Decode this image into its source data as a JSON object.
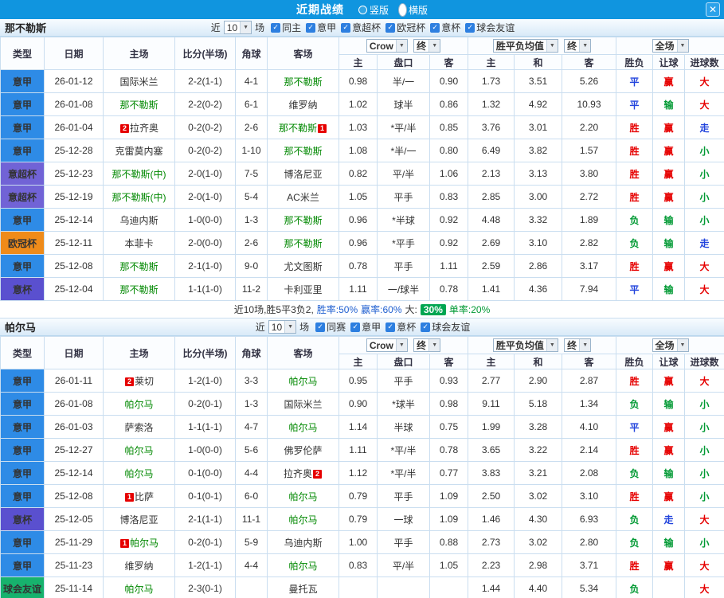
{
  "topbar": {
    "title": "近期战绩",
    "radios": [
      {
        "label": "竖版",
        "selected": false
      },
      {
        "label": "横版",
        "selected": true
      }
    ],
    "close_icon": "✕"
  },
  "table_header": {
    "type": "类型",
    "date": "日期",
    "home": "主场",
    "score": "比分(半场)",
    "corner": "角球",
    "away": "客场",
    "bookmaker_select": "Crow",
    "final_select": "终",
    "odds_select": "胜平负均值",
    "scope_select": "全场",
    "sub_home": "主",
    "sub_handicap": "盘口",
    "sub_away": "客",
    "sub_win": "主",
    "sub_draw": "和",
    "sub_lose": "客",
    "sub_result": "胜负",
    "sub_letball": "让球",
    "sub_goals": "进球数"
  },
  "team_colors": {
    "focus": "#008800",
    "normal": "#333333"
  },
  "type_colors": {
    "意甲": "#2e8be6",
    "意超杯": "#7163d6",
    "欧冠杯": "#ef8b1a",
    "意杯": "#5a50cf",
    "球会友谊": "#17b26d"
  },
  "result_colors": {
    "胜": "#e60000",
    "赢": "#e60000",
    "大": "#e60000",
    "负": "#009933",
    "输": "#009933",
    "小": "#009933",
    "平": "#2244dd",
    "走": "#2244dd"
  },
  "sections": [
    {
      "team": "那不勒斯",
      "filter": {
        "recent_label": "近",
        "recent_count": "10",
        "unit_label": "场",
        "checkboxes": [
          {
            "label": "同主",
            "checked": true
          },
          {
            "label": "意甲",
            "checked": true
          },
          {
            "label": "意超杯",
            "checked": true
          },
          {
            "label": "欧冠杯",
            "checked": true
          },
          {
            "label": "意杯",
            "checked": true
          },
          {
            "label": "球会友谊",
            "checked": true
          }
        ]
      },
      "rows": [
        {
          "type": "意甲",
          "date": "26-01-12",
          "home": "国际米兰",
          "home_green": false,
          "home_badge": "",
          "score": "2-2(1-1)",
          "corner": "4-1",
          "away": "那不勒斯",
          "away_green": true,
          "away_badge": "",
          "ah_home": "0.98",
          "handicap": "半/一",
          "ah_away": "0.90",
          "odds_home": "1.73",
          "odds_draw": "3.51",
          "odds_away": "5.26",
          "result": "平",
          "letball": "赢",
          "goals": "大"
        },
        {
          "type": "意甲",
          "date": "26-01-08",
          "home": "那不勒斯",
          "home_green": true,
          "home_badge": "",
          "score": "2-2(0-2)",
          "corner": "6-1",
          "away": "维罗纳",
          "away_green": false,
          "away_badge": "",
          "ah_home": "1.02",
          "handicap": "球半",
          "ah_away": "0.86",
          "odds_home": "1.32",
          "odds_draw": "4.92",
          "odds_away": "10.93",
          "result": "平",
          "letball": "输",
          "goals": "大"
        },
        {
          "type": "意甲",
          "date": "26-01-04",
          "home": "拉齐奥",
          "home_green": false,
          "home_badge": "2",
          "score": "0-2(0-2)",
          "corner": "2-6",
          "away": "那不勒斯",
          "away_green": true,
          "away_badge": "1",
          "ah_home": "1.03",
          "handicap": "*平/半",
          "ah_away": "0.85",
          "odds_home": "3.76",
          "odds_draw": "3.01",
          "odds_away": "2.20",
          "result": "胜",
          "letball": "赢",
          "goals": "走"
        },
        {
          "type": "意甲",
          "date": "25-12-28",
          "home": "克雷莫内塞",
          "home_green": false,
          "home_badge": "",
          "score": "0-2(0-2)",
          "corner": "1-10",
          "away": "那不勒斯",
          "away_green": true,
          "away_badge": "",
          "ah_home": "1.08",
          "handicap": "*半/一",
          "ah_away": "0.80",
          "odds_home": "6.49",
          "odds_draw": "3.82",
          "odds_away": "1.57",
          "result": "胜",
          "letball": "赢",
          "goals": "小"
        },
        {
          "type": "意超杯",
          "date": "25-12-23",
          "home": "那不勒斯(中)",
          "home_green": true,
          "home_badge": "",
          "score": "2-0(1-0)",
          "corner": "7-5",
          "away": "博洛尼亚",
          "away_green": false,
          "away_badge": "",
          "ah_home": "0.82",
          "handicap": "平/半",
          "ah_away": "1.06",
          "odds_home": "2.13",
          "odds_draw": "3.13",
          "odds_away": "3.80",
          "result": "胜",
          "letball": "赢",
          "goals": "小"
        },
        {
          "type": "意超杯",
          "date": "25-12-19",
          "home": "那不勒斯(中)",
          "home_green": true,
          "home_badge": "",
          "score": "2-0(1-0)",
          "corner": "5-4",
          "away": "AC米兰",
          "away_green": false,
          "away_badge": "",
          "ah_home": "1.05",
          "handicap": "平手",
          "ah_away": "0.83",
          "odds_home": "2.85",
          "odds_draw": "3.00",
          "odds_away": "2.72",
          "result": "胜",
          "letball": "赢",
          "goals": "小"
        },
        {
          "type": "意甲",
          "date": "25-12-14",
          "home": "乌迪内斯",
          "home_green": false,
          "home_badge": "",
          "score": "1-0(0-0)",
          "corner": "1-3",
          "away": "那不勒斯",
          "away_green": true,
          "away_badge": "",
          "ah_home": "0.96",
          "handicap": "*半球",
          "ah_away": "0.92",
          "odds_home": "4.48",
          "odds_draw": "3.32",
          "odds_away": "1.89",
          "result": "负",
          "letball": "输",
          "goals": "小"
        },
        {
          "type": "欧冠杯",
          "date": "25-12-11",
          "home": "本菲卡",
          "home_green": false,
          "home_badge": "",
          "score": "2-0(0-0)",
          "corner": "2-6",
          "away": "那不勒斯",
          "away_green": true,
          "away_badge": "",
          "ah_home": "0.96",
          "handicap": "*平手",
          "ah_away": "0.92",
          "odds_home": "2.69",
          "odds_draw": "3.10",
          "odds_away": "2.82",
          "result": "负",
          "letball": "输",
          "goals": "走"
        },
        {
          "type": "意甲",
          "date": "25-12-08",
          "home": "那不勒斯",
          "home_green": true,
          "home_badge": "",
          "score": "2-1(1-0)",
          "corner": "9-0",
          "away": "尤文图斯",
          "away_green": false,
          "away_badge": "",
          "ah_home": "0.78",
          "handicap": "平手",
          "ah_away": "1.11",
          "odds_home": "2.59",
          "odds_draw": "2.86",
          "odds_away": "3.17",
          "result": "胜",
          "letball": "赢",
          "goals": "大"
        },
        {
          "type": "意杯",
          "date": "25-12-04",
          "home": "那不勒斯",
          "home_green": true,
          "home_badge": "",
          "score": "1-1(1-0)",
          "corner": "11-2",
          "away": "卡利亚里",
          "away_green": false,
          "away_badge": "",
          "ah_home": "1.11",
          "handicap": "一/球半",
          "ah_away": "0.78",
          "odds_home": "1.41",
          "odds_draw": "4.36",
          "odds_away": "7.94",
          "result": "平",
          "letball": "输",
          "goals": "大"
        }
      ],
      "summary_segments": [
        {
          "text": "近10场,胜5平3负2,",
          "color": "#333333"
        },
        {
          "text": "胜率:50%",
          "color": "#1f5fd0"
        },
        {
          "text": "赢率:60%",
          "color": "#1f5fd0"
        },
        {
          "text": "大:",
          "color": "#333333"
        },
        {
          "text": "30%",
          "color": "#ffffff",
          "bg": "#00a651"
        },
        {
          "text": "单率:20%",
          "color": "#009933"
        }
      ]
    },
    {
      "team": "帕尔马",
      "filter": {
        "recent_label": "近",
        "recent_count": "10",
        "unit_label": "场",
        "checkboxes": [
          {
            "label": "同赛",
            "checked": true
          },
          {
            "label": "意甲",
            "checked": true
          },
          {
            "label": "意杯",
            "checked": true
          },
          {
            "label": "球会友谊",
            "checked": true
          }
        ]
      },
      "rows": [
        {
          "type": "意甲",
          "date": "26-01-11",
          "home": "莱切",
          "home_green": false,
          "home_badge": "2",
          "score": "1-2(1-0)",
          "corner": "3-3",
          "away": "帕尔马",
          "away_green": true,
          "away_badge": "",
          "ah_home": "0.95",
          "handicap": "平手",
          "ah_away": "0.93",
          "odds_home": "2.77",
          "odds_draw": "2.90",
          "odds_away": "2.87",
          "result": "胜",
          "letball": "赢",
          "goals": "大"
        },
        {
          "type": "意甲",
          "date": "26-01-08",
          "home": "帕尔马",
          "home_green": true,
          "home_badge": "",
          "score": "0-2(0-1)",
          "corner": "1-3",
          "away": "国际米兰",
          "away_green": false,
          "away_badge": "",
          "ah_home": "0.90",
          "handicap": "*球半",
          "ah_away": "0.98",
          "odds_home": "9.11",
          "odds_draw": "5.18",
          "odds_away": "1.34",
          "result": "负",
          "letball": "输",
          "goals": "小"
        },
        {
          "type": "意甲",
          "date": "26-01-03",
          "home": "萨索洛",
          "home_green": false,
          "home_badge": "",
          "score": "1-1(1-1)",
          "corner": "4-7",
          "away": "帕尔马",
          "away_green": true,
          "away_badge": "",
          "ah_home": "1.14",
          "handicap": "半球",
          "ah_away": "0.75",
          "odds_home": "1.99",
          "odds_draw": "3.28",
          "odds_away": "4.10",
          "result": "平",
          "letball": "赢",
          "goals": "小"
        },
        {
          "type": "意甲",
          "date": "25-12-27",
          "home": "帕尔马",
          "home_green": true,
          "home_badge": "",
          "score": "1-0(0-0)",
          "corner": "5-6",
          "away": "佛罗伦萨",
          "away_green": false,
          "away_badge": "",
          "ah_home": "1.11",
          "handicap": "*平/半",
          "ah_away": "0.78",
          "odds_home": "3.65",
          "odds_draw": "3.22",
          "odds_away": "2.14",
          "result": "胜",
          "letball": "赢",
          "goals": "小"
        },
        {
          "type": "意甲",
          "date": "25-12-14",
          "home": "帕尔马",
          "home_green": true,
          "home_badge": "",
          "score": "0-1(0-0)",
          "corner": "4-4",
          "away": "拉齐奥",
          "away_green": false,
          "away_badge": "2",
          "ah_home": "1.12",
          "handicap": "*平/半",
          "ah_away": "0.77",
          "odds_home": "3.83",
          "odds_draw": "3.21",
          "odds_away": "2.08",
          "result": "负",
          "letball": "输",
          "goals": "小"
        },
        {
          "type": "意甲",
          "date": "25-12-08",
          "home": "比萨",
          "home_green": false,
          "home_badge": "1",
          "score": "0-1(0-1)",
          "corner": "6-0",
          "away": "帕尔马",
          "away_green": true,
          "away_badge": "",
          "ah_home": "0.79",
          "handicap": "平手",
          "ah_away": "1.09",
          "odds_home": "2.50",
          "odds_draw": "3.02",
          "odds_away": "3.10",
          "result": "胜",
          "letball": "赢",
          "goals": "小"
        },
        {
          "type": "意杯",
          "date": "25-12-05",
          "home": "博洛尼亚",
          "home_green": false,
          "home_badge": "",
          "score": "2-1(1-1)",
          "corner": "11-1",
          "away": "帕尔马",
          "away_green": true,
          "away_badge": "",
          "ah_home": "0.79",
          "handicap": "一球",
          "ah_away": "1.09",
          "odds_home": "1.46",
          "odds_draw": "4.30",
          "odds_away": "6.93",
          "result": "负",
          "letball": "走",
          "goals": "大"
        },
        {
          "type": "意甲",
          "date": "25-11-29",
          "home": "帕尔马",
          "home_green": true,
          "home_badge": "1",
          "score": "0-2(0-1)",
          "corner": "5-9",
          "away": "乌迪内斯",
          "away_green": false,
          "away_badge": "",
          "ah_home": "1.00",
          "handicap": "平手",
          "ah_away": "0.88",
          "odds_home": "2.73",
          "odds_draw": "3.02",
          "odds_away": "2.80",
          "result": "负",
          "letball": "输",
          "goals": "小"
        },
        {
          "type": "意甲",
          "date": "25-11-23",
          "home": "维罗纳",
          "home_green": false,
          "home_badge": "",
          "score": "1-2(1-1)",
          "corner": "4-4",
          "away": "帕尔马",
          "away_green": true,
          "away_badge": "",
          "ah_home": "0.83",
          "handicap": "平/半",
          "ah_away": "1.05",
          "odds_home": "2.23",
          "odds_draw": "2.98",
          "odds_away": "3.71",
          "result": "胜",
          "letball": "赢",
          "goals": "大"
        },
        {
          "type": "球会友谊",
          "date": "25-11-14",
          "home": "帕尔马",
          "home_green": true,
          "home_badge": "",
          "score": "2-3(0-1)",
          "corner": "",
          "away": "曼托瓦",
          "away_green": false,
          "away_badge": "",
          "ah_home": "",
          "handicap": "",
          "ah_away": "",
          "odds_home": "1.44",
          "odds_draw": "4.40",
          "odds_away": "5.34",
          "result": "负",
          "letball": "",
          "goals": "大"
        }
      ],
      "summary_segments": []
    }
  ]
}
